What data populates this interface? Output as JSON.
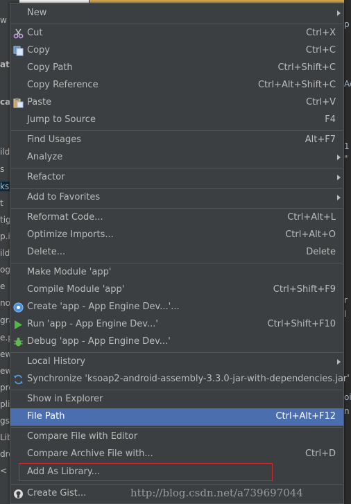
{
  "menu": {
    "items": [
      {
        "label": "New",
        "shortcut": "",
        "icon": "",
        "submenu": true
      },
      {
        "label": "Cut",
        "shortcut": "Ctrl+X",
        "icon": "scissors-icon",
        "submenu": false
      },
      {
        "label": "Copy",
        "shortcut": "Ctrl+C",
        "icon": "copy-icon",
        "submenu": false
      },
      {
        "label": "Copy Path",
        "shortcut": "Ctrl+Shift+C",
        "icon": "",
        "submenu": false
      },
      {
        "label": "Copy Reference",
        "shortcut": "Ctrl+Alt+Shift+C",
        "icon": "",
        "submenu": false
      },
      {
        "label": "Paste",
        "shortcut": "Ctrl+V",
        "icon": "paste-icon",
        "submenu": false
      },
      {
        "label": "Jump to Source",
        "shortcut": "F4",
        "icon": "",
        "submenu": false
      },
      {
        "label": "Find Usages",
        "shortcut": "Alt+F7",
        "icon": "",
        "submenu": false
      },
      {
        "label": "Analyze",
        "shortcut": "",
        "icon": "",
        "submenu": true
      },
      {
        "label": "Refactor",
        "shortcut": "",
        "icon": "",
        "submenu": true
      },
      {
        "label": "Add to Favorites",
        "shortcut": "",
        "icon": "",
        "submenu": true
      },
      {
        "label": "Reformat Code...",
        "shortcut": "Ctrl+Alt+L",
        "icon": "",
        "submenu": false
      },
      {
        "label": "Optimize Imports...",
        "shortcut": "Ctrl+Alt+O",
        "icon": "",
        "submenu": false
      },
      {
        "label": "Delete...",
        "shortcut": "Delete",
        "icon": "",
        "submenu": false
      },
      {
        "label": "Make Module 'app'",
        "shortcut": "",
        "icon": "",
        "submenu": false
      },
      {
        "label": "Compile Module 'app'",
        "shortcut": "Ctrl+Shift+F9",
        "icon": "",
        "submenu": false
      },
      {
        "label": "Create 'app - App Engine Dev...'...",
        "shortcut": "",
        "icon": "app-engine-icon",
        "submenu": false
      },
      {
        "label": "Run 'app - App Engine Dev...'",
        "shortcut": "Ctrl+Shift+F10",
        "icon": "run-icon",
        "submenu": false
      },
      {
        "label": "Debug 'app - App Engine Dev...'",
        "shortcut": "",
        "icon": "debug-icon",
        "submenu": false
      },
      {
        "label": "Local History",
        "shortcut": "",
        "icon": "",
        "submenu": true
      },
      {
        "label": "Synchronize 'ksoap2-android-assembly-3.3.0-jar-with-dependencies.jar'",
        "shortcut": "",
        "icon": "sync-icon",
        "submenu": false
      },
      {
        "label": "Show in Explorer",
        "shortcut": "",
        "icon": "",
        "submenu": false
      },
      {
        "label": "File Path",
        "shortcut": "Ctrl+Alt+F12",
        "icon": "",
        "submenu": false,
        "selected": true
      },
      {
        "label": "Compare File with Editor",
        "shortcut": "",
        "icon": "",
        "submenu": false
      },
      {
        "label": "Compare Archive File with...",
        "shortcut": "Ctrl+D",
        "icon": "",
        "submenu": false
      },
      {
        "label": "Add As Library...",
        "shortcut": "",
        "icon": "",
        "submenu": false,
        "highlighted": true
      },
      {
        "label": "Create Gist...",
        "shortcut": "",
        "icon": "github-icon",
        "submenu": false
      }
    ]
  },
  "background": {
    "left_fragments": [
      "w",
      "atio",
      "ca",
      "ild",
      "s",
      "ks",
      "t",
      "tig",
      "p.i",
      "ild",
      "og",
      "e",
      "nor",
      "gra",
      "e.p",
      "ew",
      "ew.",
      "pro",
      "pli",
      "gs.",
      "Lib",
      "dro",
      "<"
    ],
    "right_fragments": [
      "p",
      "Ac",
      "1",
      "\"",
      "r",
      "l",
      "oi",
      "n"
    ]
  },
  "watermark": "http://blog.csdn.net/a739697044",
  "colors": {
    "menu_bg": "#3c3f41",
    "selection": "#4b6eaf",
    "highlight_box": "#d22a2a"
  }
}
